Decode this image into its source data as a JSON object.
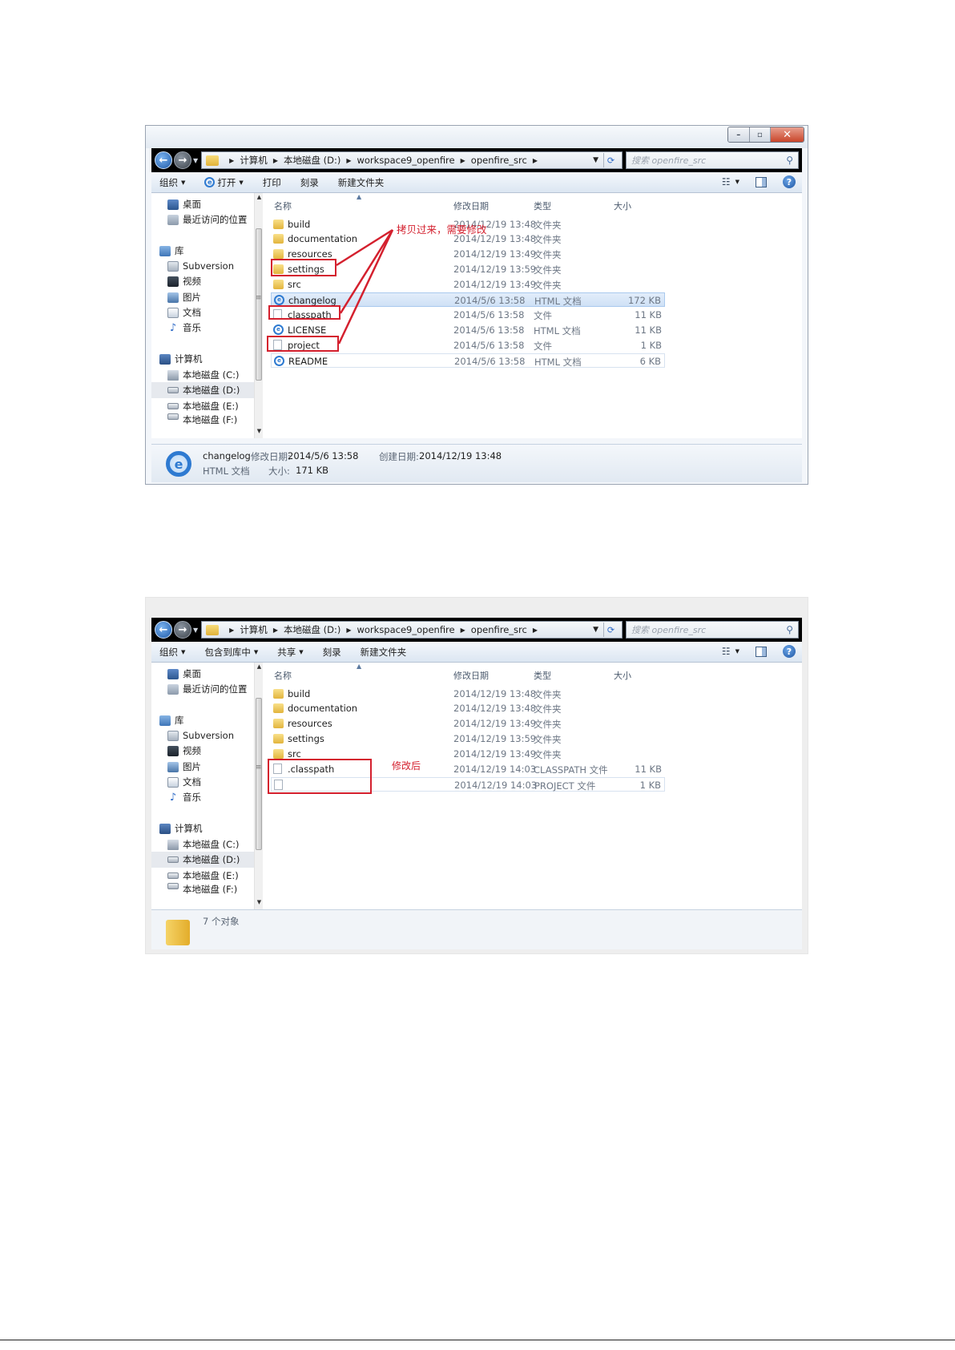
{
  "breadcrumb": [
    "计算机",
    "本地磁盘 (D:)",
    "workspace9_openfire",
    "openfire_src"
  ],
  "search_placeholder": "搜索 openfire_src",
  "columns": {
    "name": "名称",
    "date": "修改日期",
    "type": "类型",
    "size": "大小"
  },
  "nav": {
    "desktop": "桌面",
    "recent": "最近访问的位置",
    "libraries": "库",
    "subversion": "Subversion",
    "videos": "视频",
    "pictures": "图片",
    "documents": "文档",
    "music": "音乐",
    "computer": "计算机",
    "drive_c": "本地磁盘 (C:)",
    "drive_d": "本地磁盘 (D:)",
    "drive_e": "本地磁盘 (E:)",
    "drive_f": "本地磁盘 (F:)"
  },
  "window1": {
    "toolbar": {
      "organize": "组织",
      "open": "打开",
      "print": "打印",
      "burn": "刻录",
      "new_folder": "新建文件夹"
    },
    "files": [
      {
        "name": "build",
        "date": "2014/12/19 13:48",
        "type": "文件夹",
        "size": ""
      },
      {
        "name": "documentation",
        "date": "2014/12/19 13:48",
        "type": "文件夹",
        "size": ""
      },
      {
        "name": "resources",
        "date": "2014/12/19 13:49",
        "type": "文件夹",
        "size": ""
      },
      {
        "name": "settings",
        "date": "2014/12/19 13:59",
        "type": "文件夹",
        "size": ""
      },
      {
        "name": "src",
        "date": "2014/12/19 13:49",
        "type": "文件夹",
        "size": ""
      },
      {
        "name": "changelog",
        "date": "2014/5/6 13:58",
        "type": "HTML 文档",
        "size": "172 KB"
      },
      {
        "name": "classpath",
        "date": "2014/5/6 13:58",
        "type": "文件",
        "size": "11 KB"
      },
      {
        "name": "LICENSE",
        "date": "2014/5/6 13:58",
        "type": "HTML 文档",
        "size": "11 KB"
      },
      {
        "name": "project",
        "date": "2014/5/6 13:58",
        "type": "文件",
        "size": "1 KB"
      },
      {
        "name": "README",
        "date": "2014/5/6 13:58",
        "type": "HTML 文档",
        "size": "6 KB"
      }
    ],
    "annotation": "拷贝过来，需要修改",
    "status": {
      "name": "changelog",
      "modified_label": "修改日期:",
      "modified": "2014/5/6 13:58",
      "created_label": "创建日期:",
      "created": "2014/12/19 13:48",
      "type": "HTML 文档",
      "size_label": "大小:",
      "size": "171 KB"
    }
  },
  "window2": {
    "toolbar": {
      "organize": "组织",
      "include": "包含到库中",
      "share": "共享",
      "burn": "刻录",
      "new_folder": "新建文件夹"
    },
    "files": [
      {
        "name": "build",
        "date": "2014/12/19 13:48",
        "type": "文件夹",
        "size": ""
      },
      {
        "name": "documentation",
        "date": "2014/12/19 13:48",
        "type": "文件夹",
        "size": ""
      },
      {
        "name": "resources",
        "date": "2014/12/19 13:49",
        "type": "文件夹",
        "size": ""
      },
      {
        "name": "settings",
        "date": "2014/12/19 13:59",
        "type": "文件夹",
        "size": ""
      },
      {
        "name": "src",
        "date": "2014/12/19 13:49",
        "type": "文件夹",
        "size": ""
      },
      {
        "name": ".classpath",
        "date": "2014/12/19 14:03",
        "type": "CLASSPATH 文件",
        "size": "11 KB"
      },
      {
        "name": "",
        "date": "2014/12/19 14:03",
        "type": "PROJECT 文件",
        "size": "1 KB"
      }
    ],
    "annotation": "修改后",
    "status": {
      "count": "7 个对象"
    }
  }
}
